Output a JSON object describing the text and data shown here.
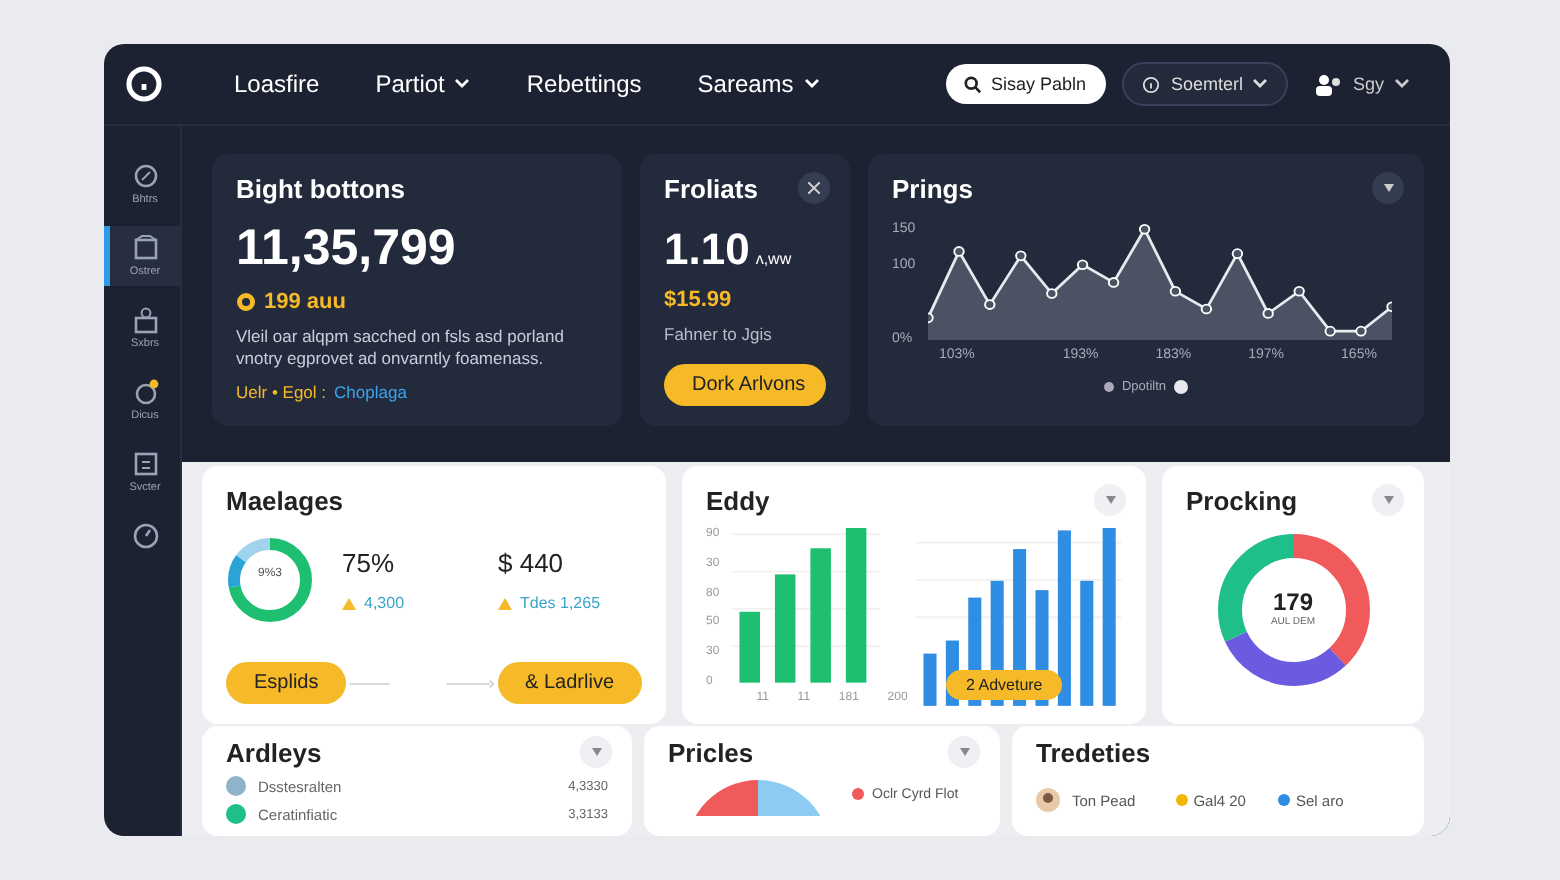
{
  "header": {
    "nav": [
      {
        "label": "Loasfire",
        "dropdown": false
      },
      {
        "label": "Partiot",
        "dropdown": true
      },
      {
        "label": "Rebettings",
        "dropdown": false
      },
      {
        "label": "Sareams",
        "dropdown": true
      }
    ],
    "search": {
      "placeholder": "Sisay Pabln"
    },
    "status_menu": {
      "label": "Soemterl"
    },
    "user_menu": {
      "label": "Sgy"
    }
  },
  "sidebar": {
    "items": [
      {
        "label": "Bhtrs",
        "selected": false
      },
      {
        "label": "Ostrer",
        "selected": true
      },
      {
        "label": "Sxbrs",
        "selected": false
      },
      {
        "label": "Dicus",
        "selected": false
      },
      {
        "label": "Svcter",
        "selected": false
      },
      {
        "selected": false
      }
    ]
  },
  "balance_card": {
    "title": "Bight bottons",
    "value": "11,35,799",
    "delta": "199 auu",
    "description": "Vleil oar alqpm sacched on fsls asd porland vnotry egprovet ad onvarntly foamenass.",
    "footer_text": "Uelr • Egol :",
    "footer_link": "Choplaga"
  },
  "profit_card": {
    "title": "Froliats",
    "value": "1.10",
    "unit": "ʌ,ww",
    "price": "$15.99",
    "caption": "Fahner to Jgis",
    "button": "Dork Arlvons"
  },
  "line_card": {
    "title": "Prings",
    "chart_data": {
      "type": "area",
      "categories": [
        null,
        "103%",
        null,
        null,
        null,
        "193%",
        null,
        null,
        "183%",
        null,
        null,
        "197%",
        null,
        null,
        "165%",
        null
      ],
      "ylim": [
        0,
        150
      ],
      "yticks": [
        {
          "value": 0,
          "label": "0%"
        },
        100,
        150
      ],
      "series": [
        {
          "name": "Dpotiltn",
          "color": "#e8eaf0",
          "values": [
            30,
            120,
            48,
            114,
            63,
            102,
            78,
            150,
            66,
            42,
            117,
            36,
            66,
            12,
            12,
            45
          ]
        }
      ]
    }
  },
  "messages_card": {
    "title": "Maelages",
    "donut_label": "9%3",
    "stats": [
      {
        "value": "75%",
        "delta": "4,300"
      },
      {
        "value": "$ 440",
        "delta": "Tdes 1,265"
      }
    ],
    "buttons": [
      "Esplids",
      "& Ladrlive"
    ]
  },
  "eddy_card": {
    "title": "Eddy",
    "y_labels": [
      "90",
      "30",
      "80",
      "50",
      "30",
      "0"
    ],
    "x_labels": [
      "11",
      "11",
      "181",
      "200"
    ],
    "badge": "2 Adveture"
  },
  "procking_card": {
    "title": "Procking",
    "value": "179",
    "caption": "AUL DEM"
  },
  "activity_card": {
    "title": "Ardleys",
    "rows": [
      {
        "name": "Dsstesralten",
        "value": "4,3330"
      },
      {
        "name": "Ceratinfiatic",
        "value": "3,3133"
      }
    ]
  },
  "prices_card": {
    "title": "Pricles",
    "legend": "Oclr Cyrd Flot"
  },
  "trades_card": {
    "title": "Tredeties",
    "name": "Ton Pead",
    "tags": [
      {
        "label": "Gal4 20",
        "color": "#f2b705"
      },
      {
        "label": "Sel aro",
        "color": "#2f8de4"
      }
    ]
  }
}
